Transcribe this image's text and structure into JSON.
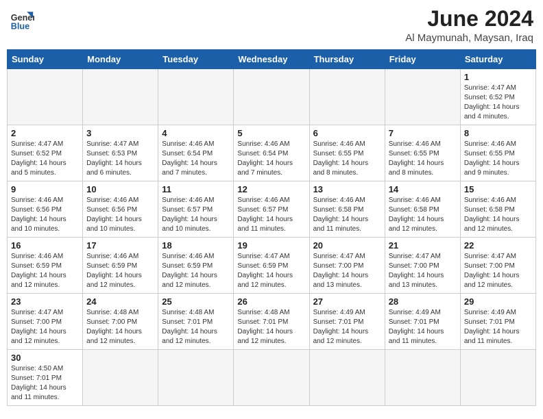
{
  "logo": {
    "general": "General",
    "blue": "Blue"
  },
  "header": {
    "month_year": "June 2024",
    "location": "Al Maymunah, Maysan, Iraq"
  },
  "weekdays": [
    "Sunday",
    "Monday",
    "Tuesday",
    "Wednesday",
    "Thursday",
    "Friday",
    "Saturday"
  ],
  "days": [
    {
      "date": null,
      "number": "",
      "info": ""
    },
    {
      "date": null,
      "number": "",
      "info": ""
    },
    {
      "date": null,
      "number": "",
      "info": ""
    },
    {
      "date": null,
      "number": "",
      "info": ""
    },
    {
      "date": null,
      "number": "",
      "info": ""
    },
    {
      "date": null,
      "number": "",
      "info": ""
    },
    {
      "date": "1",
      "number": "1",
      "info": "Sunrise: 4:47 AM\nSunset: 6:52 PM\nDaylight: 14 hours and 4 minutes."
    },
    {
      "date": "2",
      "number": "2",
      "info": "Sunrise: 4:47 AM\nSunset: 6:52 PM\nDaylight: 14 hours and 5 minutes."
    },
    {
      "date": "3",
      "number": "3",
      "info": "Sunrise: 4:47 AM\nSunset: 6:53 PM\nDaylight: 14 hours and 6 minutes."
    },
    {
      "date": "4",
      "number": "4",
      "info": "Sunrise: 4:46 AM\nSunset: 6:54 PM\nDaylight: 14 hours and 7 minutes."
    },
    {
      "date": "5",
      "number": "5",
      "info": "Sunrise: 4:46 AM\nSunset: 6:54 PM\nDaylight: 14 hours and 7 minutes."
    },
    {
      "date": "6",
      "number": "6",
      "info": "Sunrise: 4:46 AM\nSunset: 6:55 PM\nDaylight: 14 hours and 8 minutes."
    },
    {
      "date": "7",
      "number": "7",
      "info": "Sunrise: 4:46 AM\nSunset: 6:55 PM\nDaylight: 14 hours and 8 minutes."
    },
    {
      "date": "8",
      "number": "8",
      "info": "Sunrise: 4:46 AM\nSunset: 6:55 PM\nDaylight: 14 hours and 9 minutes."
    },
    {
      "date": "9",
      "number": "9",
      "info": "Sunrise: 4:46 AM\nSunset: 6:56 PM\nDaylight: 14 hours and 10 minutes."
    },
    {
      "date": "10",
      "number": "10",
      "info": "Sunrise: 4:46 AM\nSunset: 6:56 PM\nDaylight: 14 hours and 10 minutes."
    },
    {
      "date": "11",
      "number": "11",
      "info": "Sunrise: 4:46 AM\nSunset: 6:57 PM\nDaylight: 14 hours and 10 minutes."
    },
    {
      "date": "12",
      "number": "12",
      "info": "Sunrise: 4:46 AM\nSunset: 6:57 PM\nDaylight: 14 hours and 11 minutes."
    },
    {
      "date": "13",
      "number": "13",
      "info": "Sunrise: 4:46 AM\nSunset: 6:58 PM\nDaylight: 14 hours and 11 minutes."
    },
    {
      "date": "14",
      "number": "14",
      "info": "Sunrise: 4:46 AM\nSunset: 6:58 PM\nDaylight: 14 hours and 12 minutes."
    },
    {
      "date": "15",
      "number": "15",
      "info": "Sunrise: 4:46 AM\nSunset: 6:58 PM\nDaylight: 14 hours and 12 minutes."
    },
    {
      "date": "16",
      "number": "16",
      "info": "Sunrise: 4:46 AM\nSunset: 6:59 PM\nDaylight: 14 hours and 12 minutes."
    },
    {
      "date": "17",
      "number": "17",
      "info": "Sunrise: 4:46 AM\nSunset: 6:59 PM\nDaylight: 14 hours and 12 minutes."
    },
    {
      "date": "18",
      "number": "18",
      "info": "Sunrise: 4:46 AM\nSunset: 6:59 PM\nDaylight: 14 hours and 12 minutes."
    },
    {
      "date": "19",
      "number": "19",
      "info": "Sunrise: 4:47 AM\nSunset: 6:59 PM\nDaylight: 14 hours and 12 minutes."
    },
    {
      "date": "20",
      "number": "20",
      "info": "Sunrise: 4:47 AM\nSunset: 7:00 PM\nDaylight: 14 hours and 13 minutes."
    },
    {
      "date": "21",
      "number": "21",
      "info": "Sunrise: 4:47 AM\nSunset: 7:00 PM\nDaylight: 14 hours and 13 minutes."
    },
    {
      "date": "22",
      "number": "22",
      "info": "Sunrise: 4:47 AM\nSunset: 7:00 PM\nDaylight: 14 hours and 12 minutes."
    },
    {
      "date": "23",
      "number": "23",
      "info": "Sunrise: 4:47 AM\nSunset: 7:00 PM\nDaylight: 14 hours and 12 minutes."
    },
    {
      "date": "24",
      "number": "24",
      "info": "Sunrise: 4:48 AM\nSunset: 7:00 PM\nDaylight: 14 hours and 12 minutes."
    },
    {
      "date": "25",
      "number": "25",
      "info": "Sunrise: 4:48 AM\nSunset: 7:01 PM\nDaylight: 14 hours and 12 minutes."
    },
    {
      "date": "26",
      "number": "26",
      "info": "Sunrise: 4:48 AM\nSunset: 7:01 PM\nDaylight: 14 hours and 12 minutes."
    },
    {
      "date": "27",
      "number": "27",
      "info": "Sunrise: 4:49 AM\nSunset: 7:01 PM\nDaylight: 14 hours and 12 minutes."
    },
    {
      "date": "28",
      "number": "28",
      "info": "Sunrise: 4:49 AM\nSunset: 7:01 PM\nDaylight: 14 hours and 11 minutes."
    },
    {
      "date": "29",
      "number": "29",
      "info": "Sunrise: 4:49 AM\nSunset: 7:01 PM\nDaylight: 14 hours and 11 minutes."
    },
    {
      "date": "30",
      "number": "30",
      "info": "Sunrise: 4:50 AM\nSunset: 7:01 PM\nDaylight: 14 hours and 11 minutes."
    },
    {
      "date": null,
      "number": "",
      "info": ""
    },
    {
      "date": null,
      "number": "",
      "info": ""
    },
    {
      "date": null,
      "number": "",
      "info": ""
    },
    {
      "date": null,
      "number": "",
      "info": ""
    },
    {
      "date": null,
      "number": "",
      "info": ""
    },
    {
      "date": null,
      "number": "",
      "info": ""
    }
  ]
}
